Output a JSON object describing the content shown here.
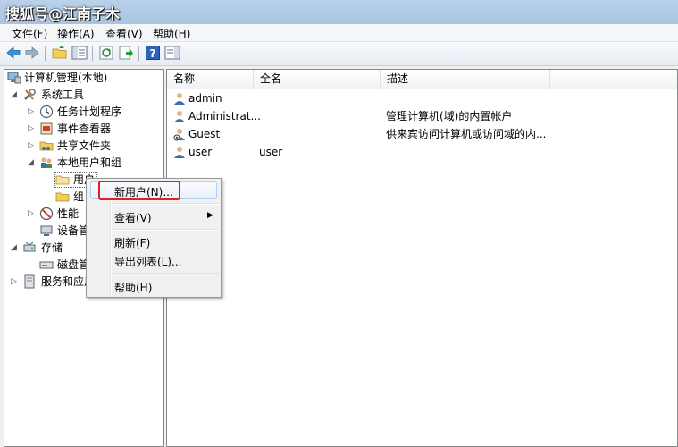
{
  "watermark": "搜狐号@江南子木",
  "menu": [
    "文件(F)",
    "操作(A)",
    "查看(V)",
    "帮助(H)"
  ],
  "tree": {
    "root": "计算机管理(本地)",
    "system_tools": "系统工具",
    "task_scheduler": "任务计划程序",
    "event_viewer": "事件查看器",
    "shared_folders": "共享文件夹",
    "local_users_groups": "本地用户和组",
    "users": "用户",
    "groups": "组",
    "performance": "性能",
    "device_manager": "设备管",
    "storage": "存储",
    "disk_mgmt": "磁盘管",
    "services_apps": "服务和应用"
  },
  "columns": [
    "名称",
    "全名",
    "描述"
  ],
  "users": [
    {
      "name": "admin",
      "full": "",
      "desc": ""
    },
    {
      "name": "Administrat...",
      "full": "",
      "desc": "管理计算机(域)的内置帐户"
    },
    {
      "name": "Guest",
      "full": "",
      "desc": "供来宾访问计算机或访问域的内..."
    },
    {
      "name": "user",
      "full": "user",
      "desc": ""
    }
  ],
  "context_menu": {
    "new_user": "新用户(N)...",
    "view": "查看(V)",
    "refresh": "刷新(F)",
    "export": "导出列表(L)...",
    "help": "帮助(H)"
  },
  "colors": {
    "highlight_box": "#e0211f",
    "title_bar": "#b9d1ea"
  }
}
